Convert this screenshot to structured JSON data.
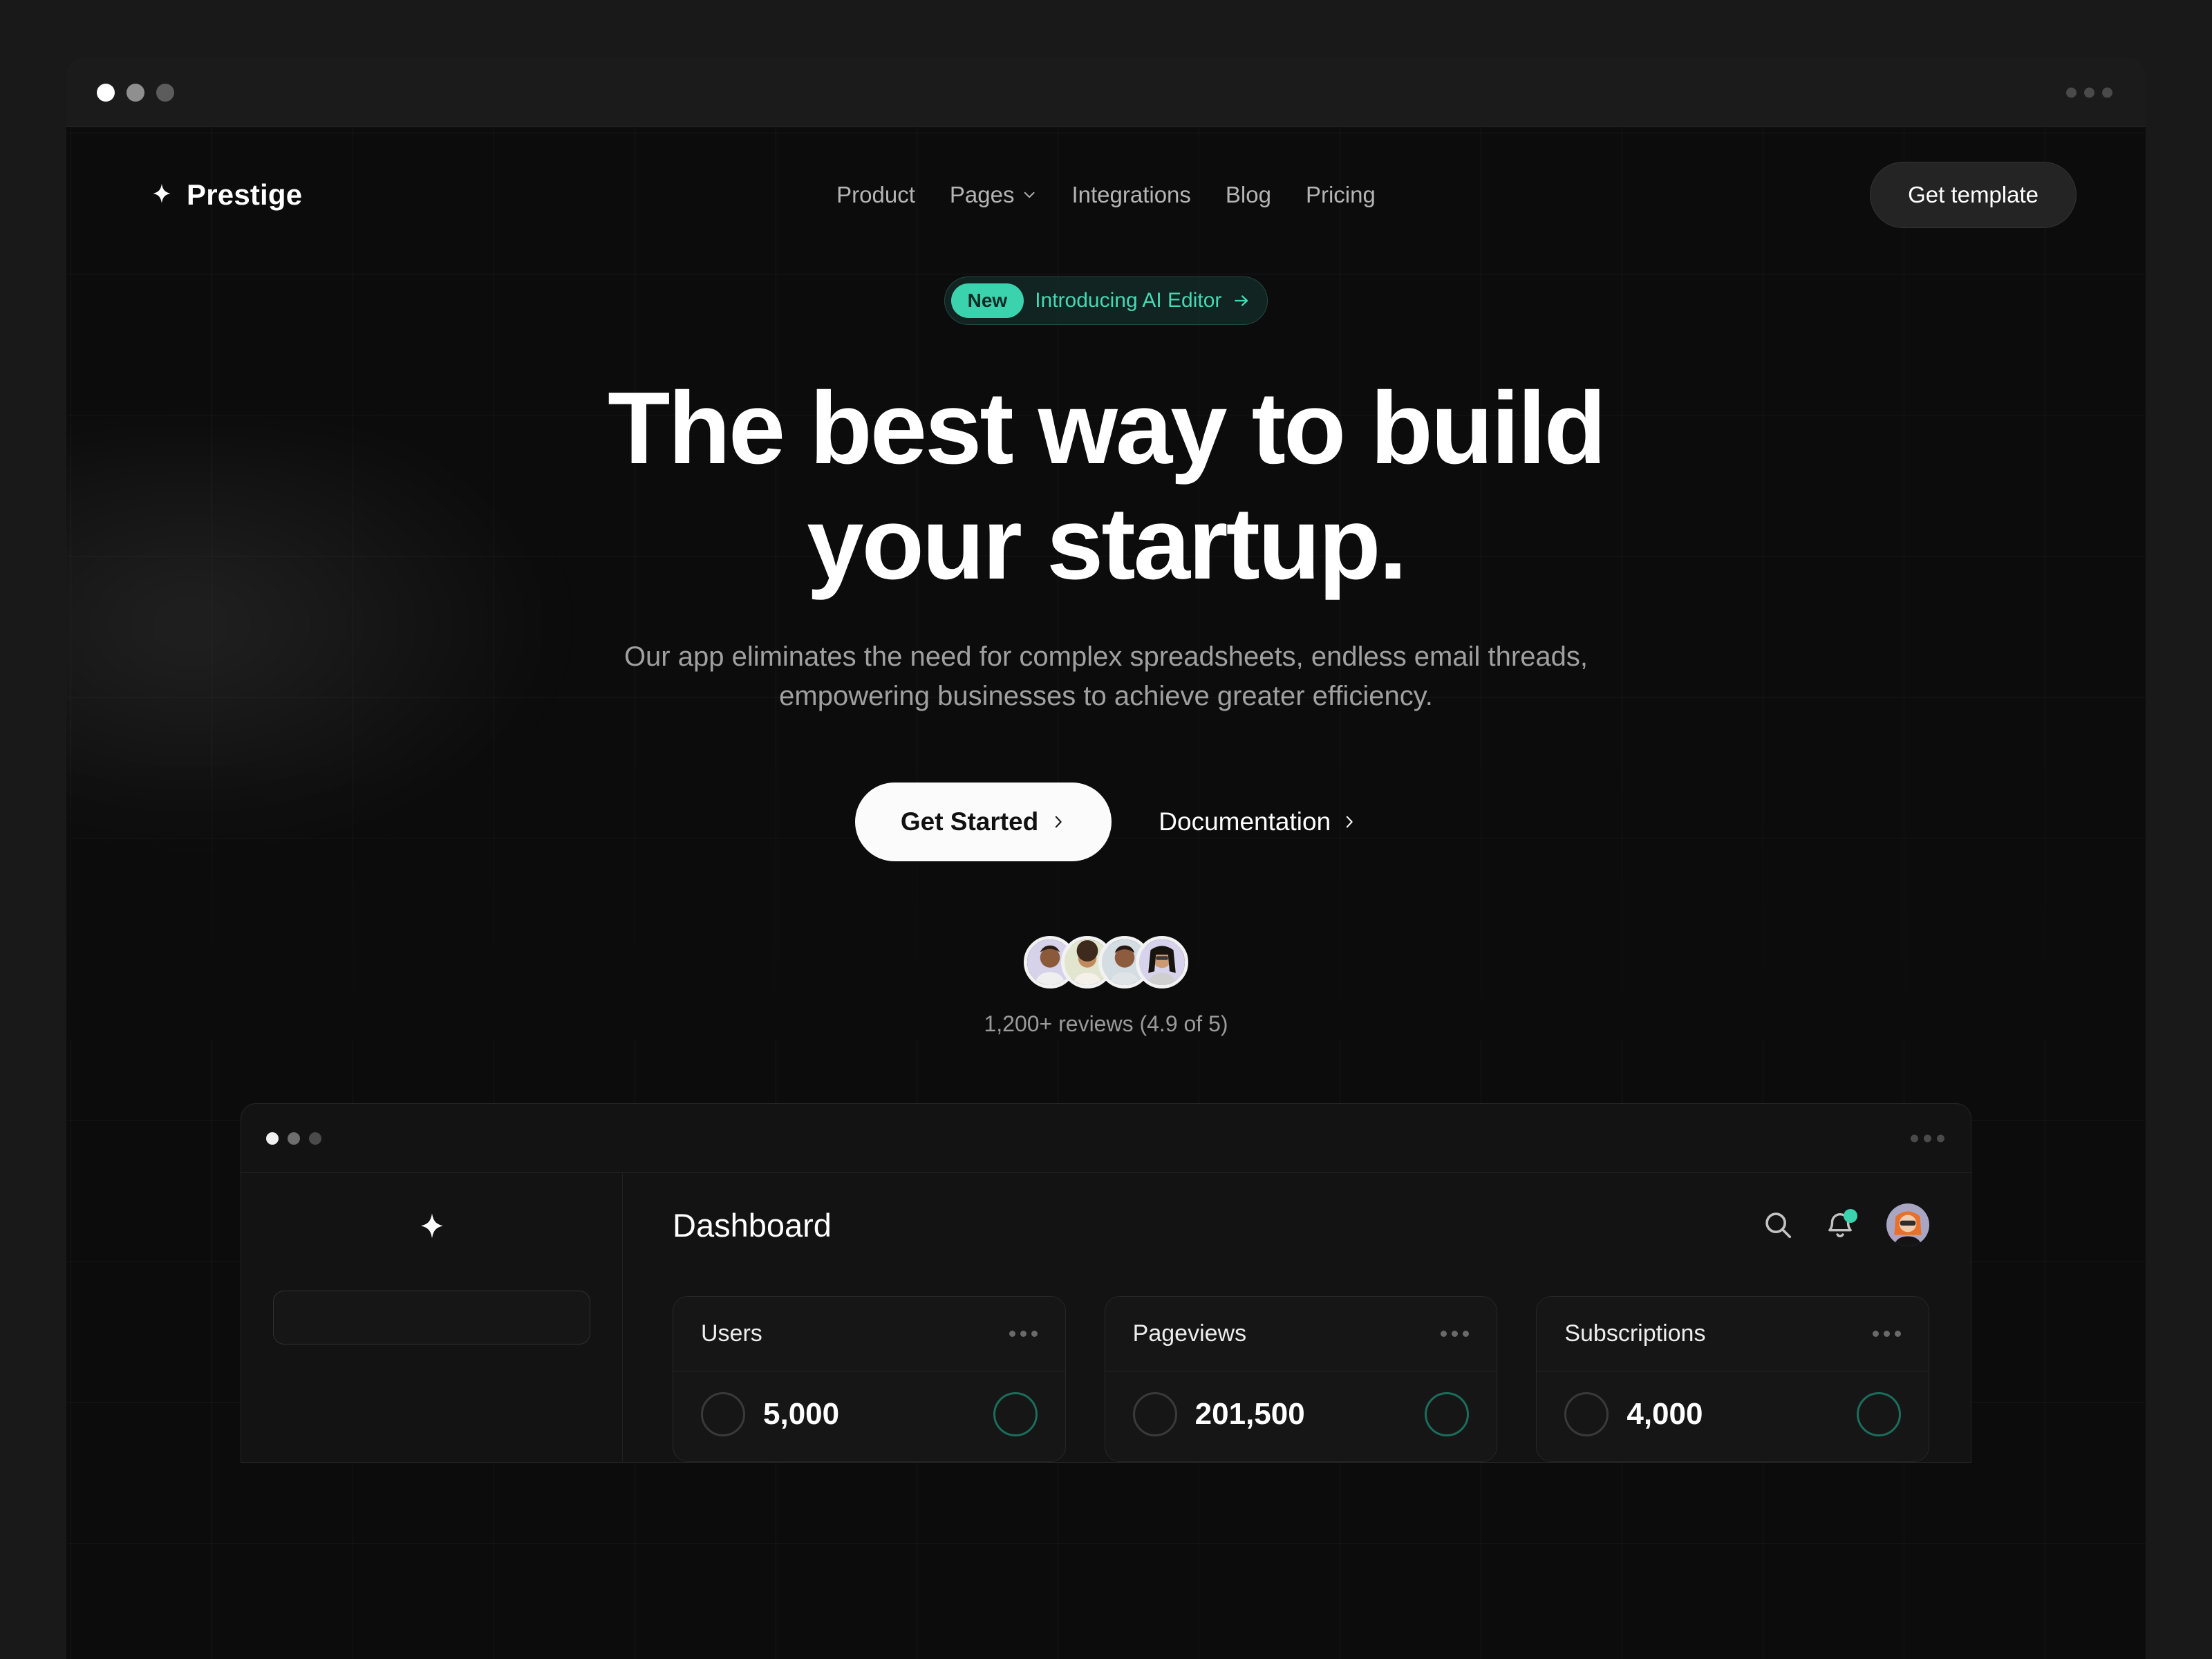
{
  "window": {
    "traffic_lights": [
      "white",
      "gray",
      "dark"
    ],
    "menu_icon": "kebab-menu-icon"
  },
  "nav": {
    "brand": {
      "name": "Prestige",
      "icon": "sparkle-icon"
    },
    "links": [
      {
        "label": "Product",
        "has_chevron": false
      },
      {
        "label": "Pages",
        "has_chevron": true
      },
      {
        "label": "Integrations",
        "has_chevron": false
      },
      {
        "label": "Blog",
        "has_chevron": false
      },
      {
        "label": "Pricing",
        "has_chevron": false
      }
    ],
    "cta_label": "Get template"
  },
  "hero": {
    "badge": {
      "pill": "New",
      "text": "Introducing AI Editor",
      "arrow_icon": "arrow-right-icon"
    },
    "title_line1": "The best way to build",
    "title_line2": "your startup.",
    "subtitle_line1": "Our app eliminates the need for complex spreadsheets, endless email threads,",
    "subtitle_line2": "empowering businesses to achieve greater efficiency.",
    "primary_cta": "Get Started",
    "secondary_cta": "Documentation",
    "reviews_text": "1,200+ reviews (4.9 of 5)",
    "avatar_count": 4
  },
  "colors": {
    "accent_teal": "#3bd3ae",
    "badge_text_teal": "#46d8b4",
    "page_bg": "#0c0c0c",
    "frame_bg": "#191919",
    "primary_button_bg": "#fbfbfb",
    "muted_text": "#a0a0a0"
  },
  "dashboard": {
    "title": "Dashboard",
    "logo_icon": "sparkle-icon",
    "search_icon": "search-icon",
    "bell_icon": "bell-icon",
    "has_notification": true,
    "avatar_icon": "user-avatar",
    "sidebar_search_placeholder": "",
    "cards": [
      {
        "label": "Users",
        "value": "5,000",
        "menu": "kebab-menu-icon"
      },
      {
        "label": "Pageviews",
        "value": "201,500",
        "menu": "kebab-menu-icon"
      },
      {
        "label": "Subscriptions",
        "value": "4,000",
        "menu": "kebab-menu-icon"
      }
    ]
  }
}
